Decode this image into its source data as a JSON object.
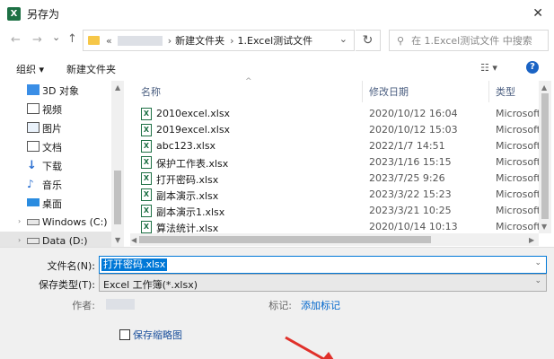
{
  "window": {
    "title": "另存为",
    "close_glyph": "✕"
  },
  "nav": {
    "back": "←",
    "forward": "→",
    "dropdown": "⌄",
    "up": "↑"
  },
  "address": {
    "prefix": "«",
    "crumbs": [
      "新建文件夹",
      "1.Excel测试文件"
    ],
    "sep": "›",
    "dropdown": "⌄",
    "refresh": "↻"
  },
  "search": {
    "placeholder": "在 1.Excel测试文件 中搜索",
    "icon": "search-icon"
  },
  "toolbar": {
    "organize": "组织 ▾",
    "new_folder": "新建文件夹",
    "view": "☷ ▾",
    "help": "?"
  },
  "sidebar": {
    "items": [
      {
        "label": "3D 对象",
        "icon": "3d-objects-icon",
        "color": "#3a8ee6"
      },
      {
        "label": "视频",
        "icon": "video-icon",
        "color": "#555555"
      },
      {
        "label": "图片",
        "icon": "pictures-icon",
        "color": "#555555"
      },
      {
        "label": "文档",
        "icon": "documents-icon",
        "color": "#555555"
      },
      {
        "label": "下载",
        "icon": "download-icon",
        "color": "#2a6fd1"
      },
      {
        "label": "音乐",
        "icon": "music-icon",
        "color": "#2a6fd1"
      },
      {
        "label": "桌面",
        "icon": "desktop-icon",
        "color": "#2a8ce0"
      },
      {
        "label": "Windows (C:)",
        "icon": "drive-icon",
        "color": "#666666"
      },
      {
        "label": "Data (D:)",
        "icon": "drive-icon",
        "color": "#666666"
      }
    ],
    "selected_index": 8
  },
  "files": {
    "columns": {
      "name": "名称",
      "date": "修改日期",
      "type": "类型"
    },
    "rows": [
      {
        "name": "2010excel.xlsx",
        "date": "2020/10/12 16:04",
        "type": "Microsoft"
      },
      {
        "name": "2019excel.xlsx",
        "date": "2020/10/12 15:03",
        "type": "Microsoft"
      },
      {
        "name": "abc123.xlsx",
        "date": "2022/1/7 14:51",
        "type": "Microsoft"
      },
      {
        "name": "保护工作表.xlsx",
        "date": "2023/1/16 15:15",
        "type": "Microsoft"
      },
      {
        "name": "打开密码.xlsx",
        "date": "2023/7/25 9:26",
        "type": "Microsoft"
      },
      {
        "name": "副本演示.xlsx",
        "date": "2023/3/22 15:23",
        "type": "Microsoft"
      },
      {
        "name": "副本演示1.xlsx",
        "date": "2023/3/21 10:25",
        "type": "Microsoft"
      },
      {
        "name": "算法统计.xlsx",
        "date": "2020/10/14 10:13",
        "type": "Microsoft"
      }
    ],
    "file_icon_letter": "X"
  },
  "form": {
    "filename_label": "文件名(N):",
    "filename_value": "打开密码.xlsx",
    "filetype_label": "保存类型(T):",
    "filetype_value": "Excel 工作簿(*.xlsx)",
    "author_label": "作者:",
    "tags_label": "标记:",
    "tags_link": "添加标记",
    "thumbnail_label": "保存缩略图"
  },
  "colors": {
    "accent": "#0078d7",
    "excel": "#1d7044",
    "arrow": "#e0302a"
  }
}
